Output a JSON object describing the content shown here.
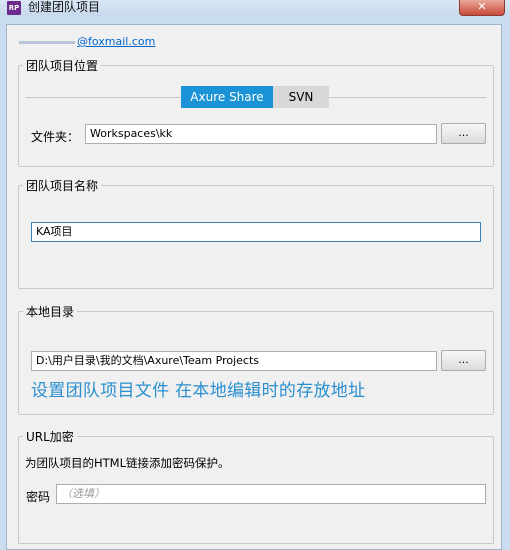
{
  "window": {
    "icon_label": "RP",
    "title": "创建团队项目",
    "close_symbol": "✕"
  },
  "account": {
    "email_suffix": "@foxmail.com"
  },
  "location": {
    "legend": "团队项目位置",
    "tabs": [
      {
        "label": "Axure Share",
        "selected": true
      },
      {
        "label": "SVN",
        "selected": false
      }
    ],
    "folder_label": "文件夹：",
    "folder_value": "Workspaces\\kk",
    "browse_label": "..."
  },
  "name": {
    "legend": "团队项目名称",
    "value": "KA项目"
  },
  "local": {
    "legend": "本地目录",
    "path_value": "D:\\用户目录\\我的文档\\Axure\\Team Projects",
    "browse_label": "...",
    "annotation": "设置团队项目文件 在本地编辑时的存放地址"
  },
  "encrypt": {
    "legend": "URL加密",
    "description": "为团队项目的HTML链接添加密码保护。",
    "password_label": "密码",
    "password_placeholder": "（选填）"
  },
  "colors": {
    "accent": "#1a94d6",
    "annotation": "#2a8fcf",
    "link": "#0066cc"
  }
}
